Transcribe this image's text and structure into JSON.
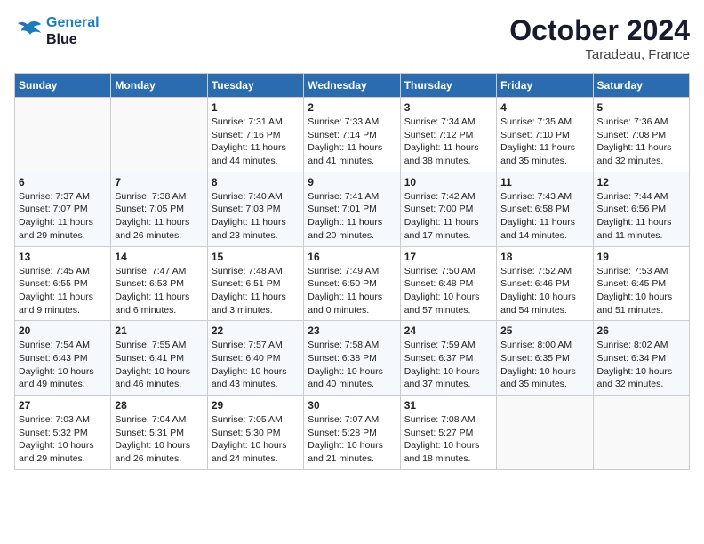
{
  "header": {
    "logo_line1": "General",
    "logo_line2": "Blue",
    "month": "October 2024",
    "location": "Taradeau, France"
  },
  "columns": [
    "Sunday",
    "Monday",
    "Tuesday",
    "Wednesday",
    "Thursday",
    "Friday",
    "Saturday"
  ],
  "weeks": [
    [
      {
        "day": "",
        "info": ""
      },
      {
        "day": "",
        "info": ""
      },
      {
        "day": "1",
        "info": "Sunrise: 7:31 AM\nSunset: 7:16 PM\nDaylight: 11 hours and 44 minutes."
      },
      {
        "day": "2",
        "info": "Sunrise: 7:33 AM\nSunset: 7:14 PM\nDaylight: 11 hours and 41 minutes."
      },
      {
        "day": "3",
        "info": "Sunrise: 7:34 AM\nSunset: 7:12 PM\nDaylight: 11 hours and 38 minutes."
      },
      {
        "day": "4",
        "info": "Sunrise: 7:35 AM\nSunset: 7:10 PM\nDaylight: 11 hours and 35 minutes."
      },
      {
        "day": "5",
        "info": "Sunrise: 7:36 AM\nSunset: 7:08 PM\nDaylight: 11 hours and 32 minutes."
      }
    ],
    [
      {
        "day": "6",
        "info": "Sunrise: 7:37 AM\nSunset: 7:07 PM\nDaylight: 11 hours and 29 minutes."
      },
      {
        "day": "7",
        "info": "Sunrise: 7:38 AM\nSunset: 7:05 PM\nDaylight: 11 hours and 26 minutes."
      },
      {
        "day": "8",
        "info": "Sunrise: 7:40 AM\nSunset: 7:03 PM\nDaylight: 11 hours and 23 minutes."
      },
      {
        "day": "9",
        "info": "Sunrise: 7:41 AM\nSunset: 7:01 PM\nDaylight: 11 hours and 20 minutes."
      },
      {
        "day": "10",
        "info": "Sunrise: 7:42 AM\nSunset: 7:00 PM\nDaylight: 11 hours and 17 minutes."
      },
      {
        "day": "11",
        "info": "Sunrise: 7:43 AM\nSunset: 6:58 PM\nDaylight: 11 hours and 14 minutes."
      },
      {
        "day": "12",
        "info": "Sunrise: 7:44 AM\nSunset: 6:56 PM\nDaylight: 11 hours and 11 minutes."
      }
    ],
    [
      {
        "day": "13",
        "info": "Sunrise: 7:45 AM\nSunset: 6:55 PM\nDaylight: 11 hours and 9 minutes."
      },
      {
        "day": "14",
        "info": "Sunrise: 7:47 AM\nSunset: 6:53 PM\nDaylight: 11 hours and 6 minutes."
      },
      {
        "day": "15",
        "info": "Sunrise: 7:48 AM\nSunset: 6:51 PM\nDaylight: 11 hours and 3 minutes."
      },
      {
        "day": "16",
        "info": "Sunrise: 7:49 AM\nSunset: 6:50 PM\nDaylight: 11 hours and 0 minutes."
      },
      {
        "day": "17",
        "info": "Sunrise: 7:50 AM\nSunset: 6:48 PM\nDaylight: 10 hours and 57 minutes."
      },
      {
        "day": "18",
        "info": "Sunrise: 7:52 AM\nSunset: 6:46 PM\nDaylight: 10 hours and 54 minutes."
      },
      {
        "day": "19",
        "info": "Sunrise: 7:53 AM\nSunset: 6:45 PM\nDaylight: 10 hours and 51 minutes."
      }
    ],
    [
      {
        "day": "20",
        "info": "Sunrise: 7:54 AM\nSunset: 6:43 PM\nDaylight: 10 hours and 49 minutes."
      },
      {
        "day": "21",
        "info": "Sunrise: 7:55 AM\nSunset: 6:41 PM\nDaylight: 10 hours and 46 minutes."
      },
      {
        "day": "22",
        "info": "Sunrise: 7:57 AM\nSunset: 6:40 PM\nDaylight: 10 hours and 43 minutes."
      },
      {
        "day": "23",
        "info": "Sunrise: 7:58 AM\nSunset: 6:38 PM\nDaylight: 10 hours and 40 minutes."
      },
      {
        "day": "24",
        "info": "Sunrise: 7:59 AM\nSunset: 6:37 PM\nDaylight: 10 hours and 37 minutes."
      },
      {
        "day": "25",
        "info": "Sunrise: 8:00 AM\nSunset: 6:35 PM\nDaylight: 10 hours and 35 minutes."
      },
      {
        "day": "26",
        "info": "Sunrise: 8:02 AM\nSunset: 6:34 PM\nDaylight: 10 hours and 32 minutes."
      }
    ],
    [
      {
        "day": "27",
        "info": "Sunrise: 7:03 AM\nSunset: 5:32 PM\nDaylight: 10 hours and 29 minutes."
      },
      {
        "day": "28",
        "info": "Sunrise: 7:04 AM\nSunset: 5:31 PM\nDaylight: 10 hours and 26 minutes."
      },
      {
        "day": "29",
        "info": "Sunrise: 7:05 AM\nSunset: 5:30 PM\nDaylight: 10 hours and 24 minutes."
      },
      {
        "day": "30",
        "info": "Sunrise: 7:07 AM\nSunset: 5:28 PM\nDaylight: 10 hours and 21 minutes."
      },
      {
        "day": "31",
        "info": "Sunrise: 7:08 AM\nSunset: 5:27 PM\nDaylight: 10 hours and 18 minutes."
      },
      {
        "day": "",
        "info": ""
      },
      {
        "day": "",
        "info": ""
      }
    ]
  ]
}
